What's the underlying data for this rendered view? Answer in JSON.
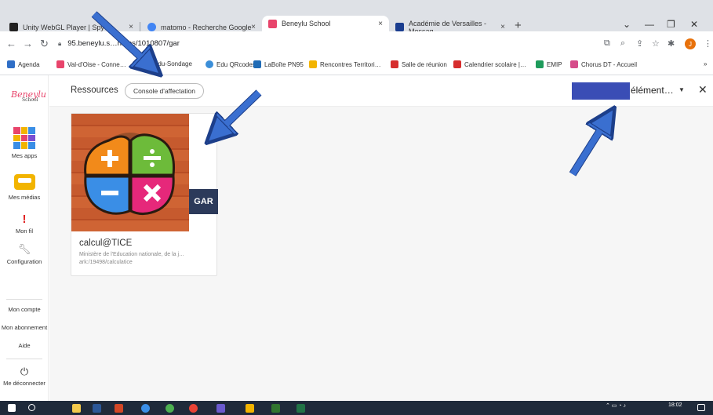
{
  "browser": {
    "tabs": [
      {
        "label": "Unity WebGL Player | Spy",
        "favicon_color": "#222222"
      },
      {
        "label": "matomo - Recherche Google",
        "favicon_color": "#4285f4"
      },
      {
        "label": "Beneylu School",
        "favicon_color": "#e8446b"
      },
      {
        "label": "Académie de Versailles - Messag",
        "favicon_color": "#1a3d8f"
      }
    ],
    "new_tab": "+",
    "close_glyph": "×",
    "url": "95.beneylu.s…na/ps/1010807/gar",
    "profile_initial": "J"
  },
  "bookmarks": [
    {
      "label": "Agenda",
      "color": "#2f6ec6"
    },
    {
      "label": "Val-d'Oise - Conne…",
      "color": "#e8446b"
    },
    {
      "label": "Edu-Sondage",
      "color": "#888888"
    },
    {
      "label": "Edu QRcodes",
      "color": "#3b8ed8"
    },
    {
      "label": "LaBoîte PN95",
      "color": "#1f6bb5"
    },
    {
      "label": "Rencontres Territori…",
      "color": "#f2b400"
    },
    {
      "label": "Salle de réunion",
      "color": "#d62d2d"
    },
    {
      "label": "Calendrier scolaire |…",
      "color": "#d62d2d"
    },
    {
      "label": "EMIP",
      "color": "#1e9b5b"
    },
    {
      "label": "Chorus DT - Accueil",
      "color": "#d64c8a"
    }
  ],
  "sidebar": {
    "logo_script": "Beneylu",
    "logo_sub": "School",
    "items": [
      {
        "label": "Mes apps"
      },
      {
        "label": "Mes médias"
      },
      {
        "label": "Mon fil"
      },
      {
        "label": "Configuration"
      }
    ],
    "links": [
      "Mon compte",
      "Mon abonnement",
      "Aide"
    ],
    "logout": "Me déconnecter"
  },
  "main": {
    "title": "Ressources",
    "console_button": "Console d'affectation",
    "element_label": "élément…",
    "card": {
      "title": "calcul@TICE",
      "publisher": "Ministère de l'Education nationale, de la j…",
      "identifier": "ark:/19498/calculatice",
      "badge": "GAR"
    }
  },
  "taskbar": {
    "time": "18:02"
  },
  "colors": {
    "annotation_arrow": "#3a6fd0",
    "brand": "#e8446b"
  }
}
